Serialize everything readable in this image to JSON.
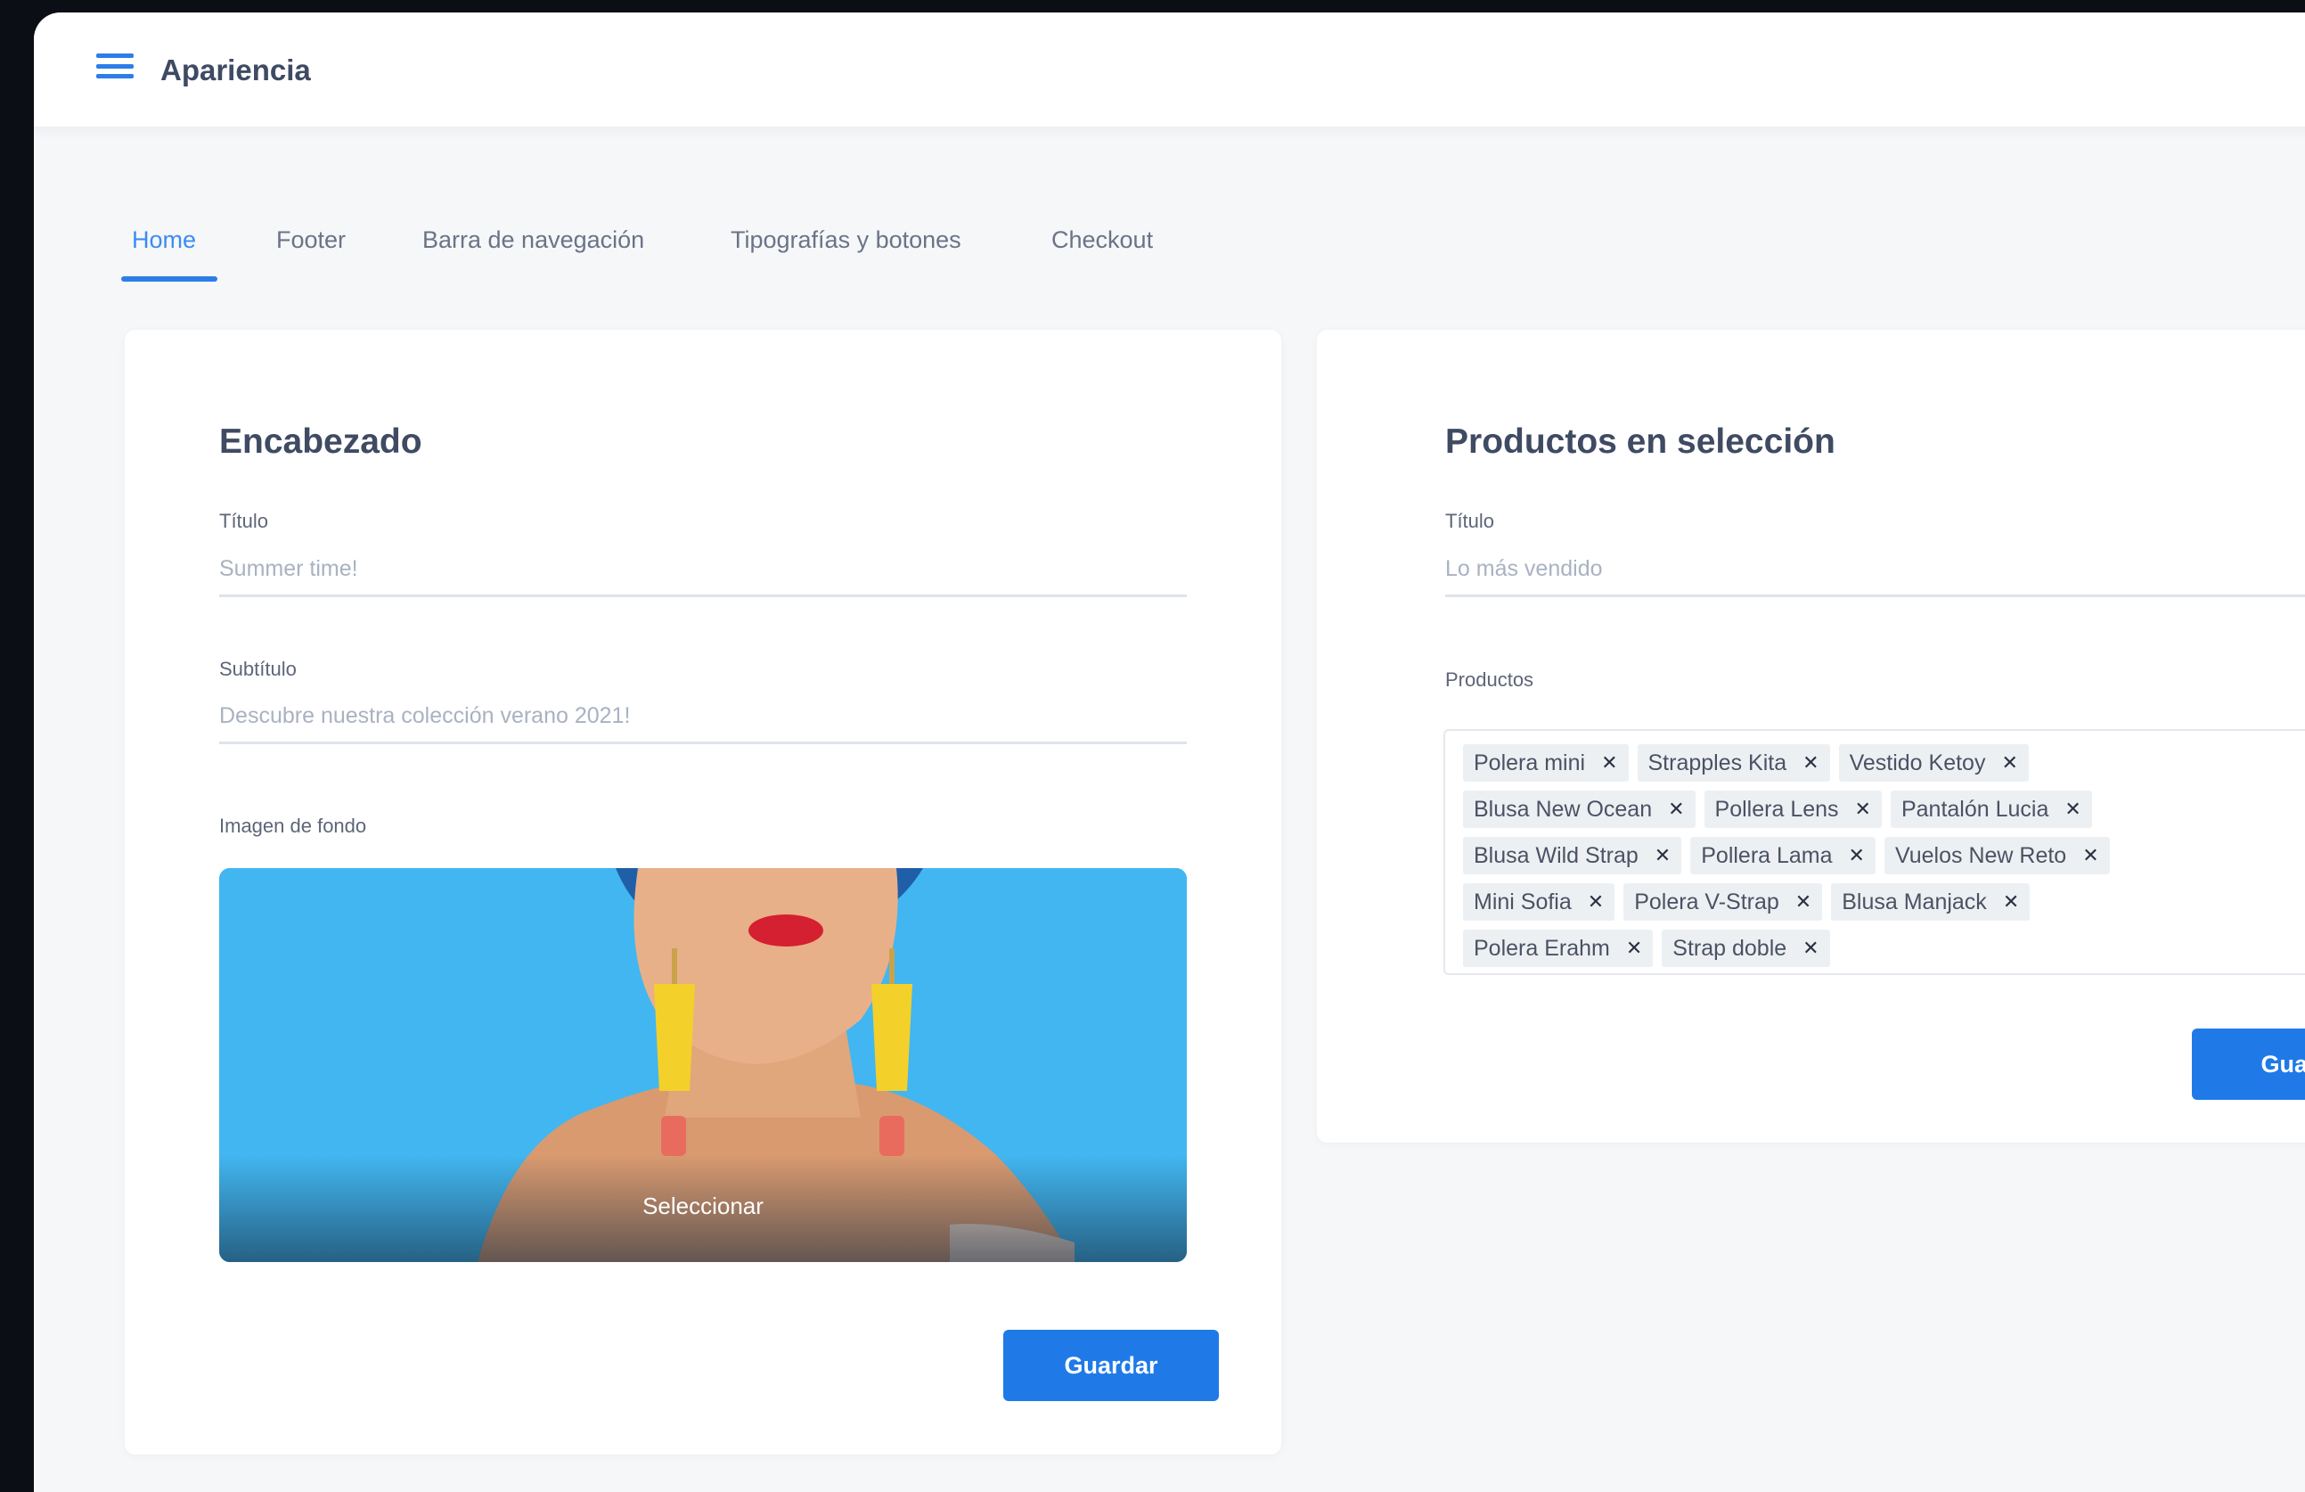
{
  "header": {
    "menu_icon": "hamburger-menu-icon",
    "title": "Apariencia"
  },
  "tabs": [
    {
      "label": "Home",
      "active": true
    },
    {
      "label": "Footer",
      "active": false
    },
    {
      "label": "Barra de navegación",
      "active": false
    },
    {
      "label": "Tipografías y botones",
      "active": false
    },
    {
      "label": "Checkout",
      "active": false
    }
  ],
  "encabezado": {
    "title": "Encabezado",
    "titulo_label": "Título",
    "titulo_placeholder": "Summer time!",
    "subtitulo_label": "Subtítulo",
    "subtitulo_placeholder": "Descubre nuestra colección verano 2021!",
    "imagen_label": "Imagen de fondo",
    "select_label": "Seleccionar",
    "save_label": "Guardar"
  },
  "productos": {
    "title": "Productos en selección",
    "titulo_label": "Título",
    "titulo_placeholder": "Lo más vendido",
    "productos_label": "Productos",
    "chip_rows": [
      [
        "Polera mini",
        "Strapples Kita",
        "Vestido Ketoy"
      ],
      [
        "Blusa New Ocean",
        "Pollera Lens",
        "Pantalón Lucia"
      ],
      [
        "Blusa Wild Strap",
        "Pollera Lama",
        "Vuelos New Reto"
      ],
      [
        "Mini Sofia",
        "Polera V-Strap",
        "Blusa Manjack"
      ],
      [
        "Polera Erahm",
        "Strap doble"
      ]
    ],
    "save_label": "Guardar"
  },
  "colors": {
    "accent": "#1f7ae8",
    "background": "#f5f7f9",
    "card": "#ffffff",
    "chip": "#edf0f3",
    "title_text": "#3f4a63"
  }
}
